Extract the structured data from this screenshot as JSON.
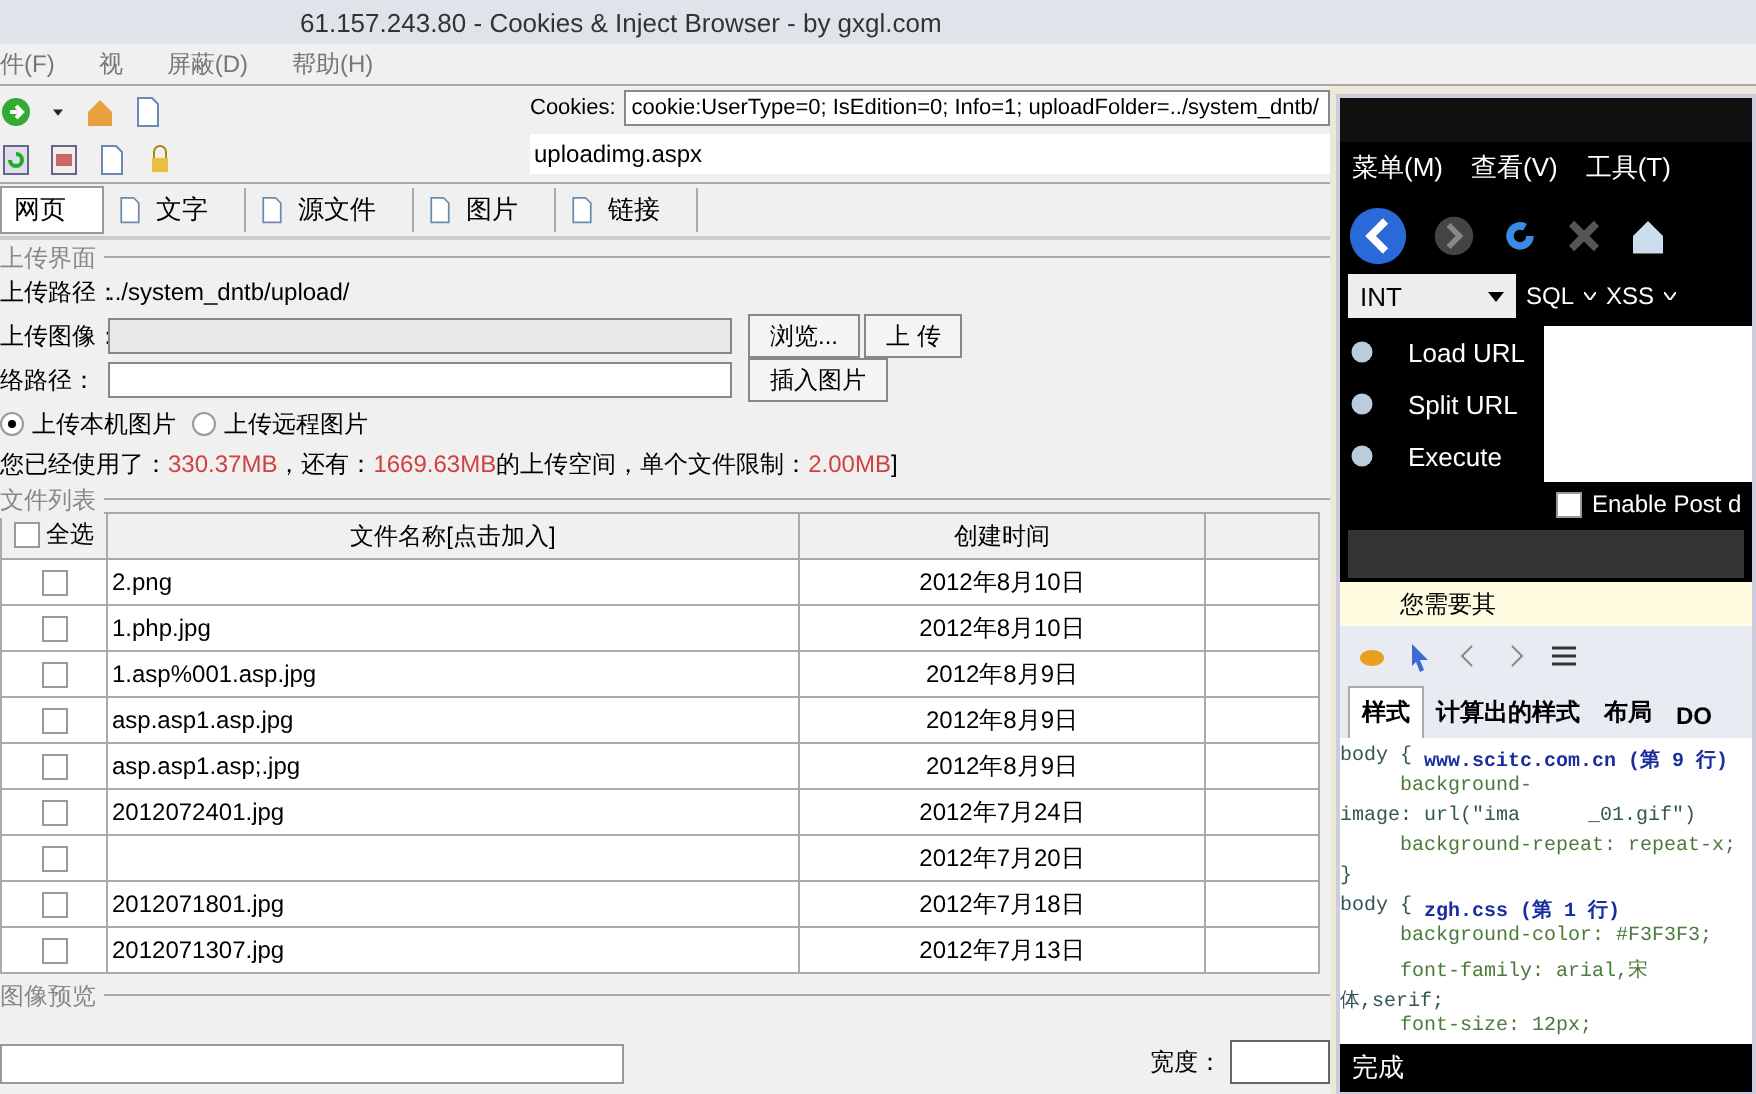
{
  "window": {
    "title": "61.157.243.80 - Cookies & Inject Browser - by gxgl.com"
  },
  "menu": [
    "件(F)",
    "视",
    "屏蔽(D)",
    "帮助(H)"
  ],
  "cookies": {
    "label": "Cookies:",
    "value": "cookie:UserType=0; IsEdition=0; Info=1; uploadFolder=../system_dntb/"
  },
  "address": {
    "value": "uploadimg.aspx"
  },
  "tabs": [
    {
      "label": "网页",
      "selected": true
    },
    {
      "label": "文字",
      "selected": false
    },
    {
      "label": "源文件",
      "selected": false
    },
    {
      "label": "图片",
      "selected": false
    },
    {
      "label": "链接",
      "selected": false
    }
  ],
  "upload": {
    "legend": "上传界面",
    "path_label": "上传路径：",
    "path": "../system_dntb/upload/",
    "image_label": "上传图像：",
    "browse": "浏览...",
    "submit": "上 传",
    "net_label": "络路径：",
    "insert": "插入图片",
    "radios": [
      {
        "label": "上传本机图片",
        "selected": true
      },
      {
        "label": "上传远程图片",
        "selected": false
      }
    ],
    "usage": [
      {
        "text": "您已经使用了：",
        "highlight": false
      },
      {
        "text": "330.37MB",
        "highlight": true
      },
      {
        "text": "，还有：",
        "highlight": false
      },
      {
        "text": "1669.63MB",
        "highlight": true
      },
      {
        "text": "的上传空间，单个文件限制：",
        "highlight": false
      },
      {
        "text": "2.00MB",
        "highlight": true
      },
      {
        "text": "]",
        "highlight": false
      }
    ]
  },
  "file_list": {
    "legend": "文件列表",
    "select_all": {
      "label": "全选",
      "checked": false
    },
    "columns": [
      "文件名称[点击加入]",
      "创建时间"
    ],
    "rows": [
      {
        "name": "2.png",
        "date": "2012年8月10日",
        "checked": false
      },
      {
        "name": "1.php.jpg",
        "date": "2012年8月10日",
        "checked": false
      },
      {
        "name": "1.asp%001.asp.jpg",
        "date": "2012年8月9日",
        "checked": false
      },
      {
        "name": "asp.asp1.asp.jpg",
        "date": "2012年8月9日",
        "checked": false
      },
      {
        "name": "asp.asp1.asp;.jpg",
        "date": "2012年8月9日",
        "checked": false
      },
      {
        "name": "2012072401.jpg",
        "date": "2012年7月24日",
        "checked": false
      },
      {
        "date": "2012年7月20日",
        "checked": false
      },
      {
        "name": "2012071801.jpg",
        "date": "2012年7月18日",
        "checked": false
      },
      {
        "name": "2012071307.jpg",
        "date": "2012年7月13日",
        "checked": false
      }
    ]
  },
  "preview": {
    "legend": "图像预览",
    "width_label": "宽度："
  },
  "side_browser": {
    "menu": [
      "菜单(M)",
      "查看(V)",
      "工具(T)"
    ],
    "mode": "INT",
    "tools": [
      "SQL",
      "XSS"
    ],
    "actions": [
      "Load URL",
      "Split URL",
      "Execute"
    ],
    "post": {
      "label": "Enable Post d",
      "checked": false
    },
    "notice": "您需要其",
    "devtools_tabs": [
      {
        "label": "样式",
        "selected": true
      },
      {
        "label": "计算出的样式",
        "selected": false
      },
      {
        "label": "布局",
        "selected": false
      },
      {
        "label": "DO",
        "selected": false
      }
    ],
    "code": [
      {
        "text": "body {",
        "source": "www.scitc.com.cn (第 9 行)",
        "indent": false
      },
      {
        "text": "background-",
        "indent": true
      },
      {
        "text": "image: url(\"ima",
        "tail": "_01.gif\")",
        "indent": false
      },
      {
        "text": "background-repeat: repeat-x;",
        "indent": true
      },
      {
        "text": "}",
        "indent": false
      },
      {
        "text": "body {",
        "source": "zgh.css (第 1 行)",
        "indent": false
      },
      {
        "text": "background-color: #F3F3F3;",
        "indent": true
      },
      {
        "text": "font-family: arial,宋",
        "indent": true
      },
      {
        "text": "体,serif;",
        "indent": false
      },
      {
        "text": "font-size: 12px;",
        "indent": true
      }
    ],
    "status": "完成"
  }
}
